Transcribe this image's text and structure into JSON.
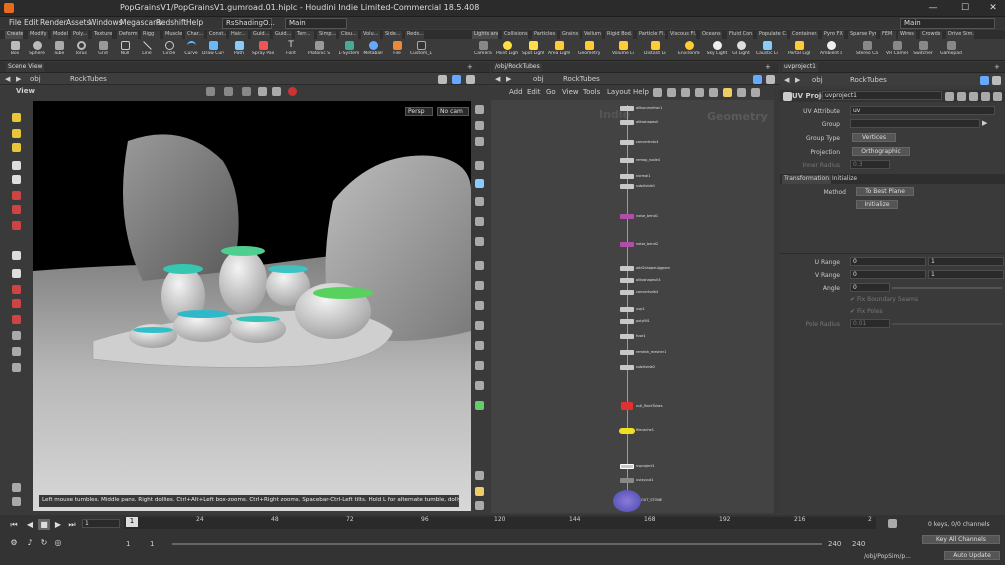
{
  "window": {
    "title": "PopGrainsV1/PopGrainsV1.gumroad.01.hiplc - Houdini Indie Limited-Commercial 18.5.408",
    "min": "—",
    "max": "☐",
    "close": "✕"
  },
  "menu": [
    "File",
    "Edit",
    "Render",
    "Assets",
    "Windows",
    "Megascans",
    "Redshift",
    "Help"
  ],
  "desktops": {
    "left": "RsShadingO...",
    "right": "Main",
    "far_right": "Main"
  },
  "shelf_tabs_left": [
    "Create",
    "Modify",
    "Model",
    "Poly...",
    "Textures",
    "Deform",
    "Rigg",
    "Muscle",
    "Char...",
    "Const...",
    "Hair...",
    "Guid...",
    "Guid...",
    "Terr...",
    "Simp...",
    "Clou...",
    "Volu...",
    "Side...",
    "Reds..."
  ],
  "shelf_tabs_right": [
    "Lights and...",
    "Collisions",
    "Particles",
    "Grains",
    "Vellum",
    "Rigid Bod...",
    "Particle Fl...",
    "Viscous Fl...",
    "Oceans",
    "Fluid Con...",
    "Populate C...",
    "Container...",
    "Pyro FX",
    "Sparse Pyr...",
    "FEM",
    "Wires",
    "Crowds",
    "Drive Sim..."
  ],
  "tools_left": [
    "Box",
    "Sphere",
    "Tube",
    "Torus",
    "Grid",
    "Null",
    "Line",
    "Circle",
    "Curve",
    "Draw Curve",
    "Path",
    "Spray Paint",
    "Font",
    "Platonic Solids",
    "L-System",
    "Metaball",
    "File",
    "Custom_LOD"
  ],
  "tools_right": [
    "Camera",
    "Point Light",
    "Spot Light",
    "Area Light",
    "Geometry Light",
    "Volume Light",
    "Distant Light",
    "Environment Light",
    "Sky Light",
    "GI Light",
    "Caustic Light",
    "Portal Light",
    "Ambient Light",
    "Stereo Camera",
    "VR Camera",
    "Switcher",
    "Gamepad Camera"
  ],
  "scene_view": {
    "tab": "Scene View",
    "path_root": "obj",
    "path_node": "RockTubes",
    "view_label": "View",
    "persp": "Persp",
    "cam": "No cam"
  },
  "viewport_hint": "Left mouse tumbles. Middle pans. Right dollies. Ctrl+Alt+Left box-zooms. Ctrl+Right zooms. Spacebar-Ctrl-Left tilts. Hold L for alternate tumble, dolly, and zoom.",
  "network": {
    "tab": "/obj/RockTubes",
    "path_root": "obj",
    "path_node": "RockTubes",
    "menu": [
      "Add",
      "Edit",
      "Go",
      "View",
      "Tools",
      "Layout",
      "Help"
    ],
    "watermark_left": "Indie",
    "watermark_right": "Geometry",
    "nodes": [
      "alltocurvefrac1",
      "alltoshapeull",
      "convertmtx4",
      "remap_node4",
      "normal1",
      "subdivide1",
      "noise_bend1",
      "noise_bend2",
      "add2shapeulggrom",
      "alltoshapeull4",
      "convertvdb4",
      "uvp1",
      "polyfill1",
      "fuse1",
      "remesh_mesher1",
      "subdivide2",
      "null_RockTubes",
      "filecache1",
      "uvproject1",
      "uvlayout1",
      "OUT_STONE"
    ]
  },
  "params": {
    "tab": "uvproject1",
    "path_root": "obj",
    "path_node": "RockTubes",
    "node_type": "UV Project",
    "node_name": "uvproject1",
    "uv_attribute_label": "UV Attribute",
    "uv_attribute": "uv",
    "group_label": "Group",
    "group": "",
    "group_type_label": "Group Type",
    "group_type": "Vertices",
    "projection_label": "Projection",
    "projection": "Orthographic",
    "inner_radius_label": "Inner Radius",
    "inner_radius": "0.3",
    "tab_transformation": "Transformation",
    "tab_initialize": "Initialize",
    "method_label": "Method",
    "method": "To Best Plane",
    "initialize_btn": "Initialize",
    "u_range_label": "U Range",
    "u_range_min": "0",
    "u_range_max": "1",
    "v_range_label": "V Range",
    "v_range_min": "0",
    "v_range_max": "1",
    "angle_label": "Angle",
    "angle": "0",
    "fix_seams_label": "Fix Boundary Seams",
    "fix_poles_label": "Fix Poles",
    "pole_radius_label": "Pole Radius",
    "pole_radius": "0.01"
  },
  "timeline": {
    "frame": "1",
    "ticks": [
      "24",
      "48",
      "72",
      "96",
      "120",
      "144",
      "168",
      "192",
      "216",
      "2"
    ],
    "start": "1",
    "start2": "1",
    "end": "240",
    "end2": "240",
    "keys": "0 keys, 0/0 channels",
    "key_all": "Key All Channels",
    "path": "/obj/PopSim/p...",
    "auto_update": "Auto Update"
  }
}
